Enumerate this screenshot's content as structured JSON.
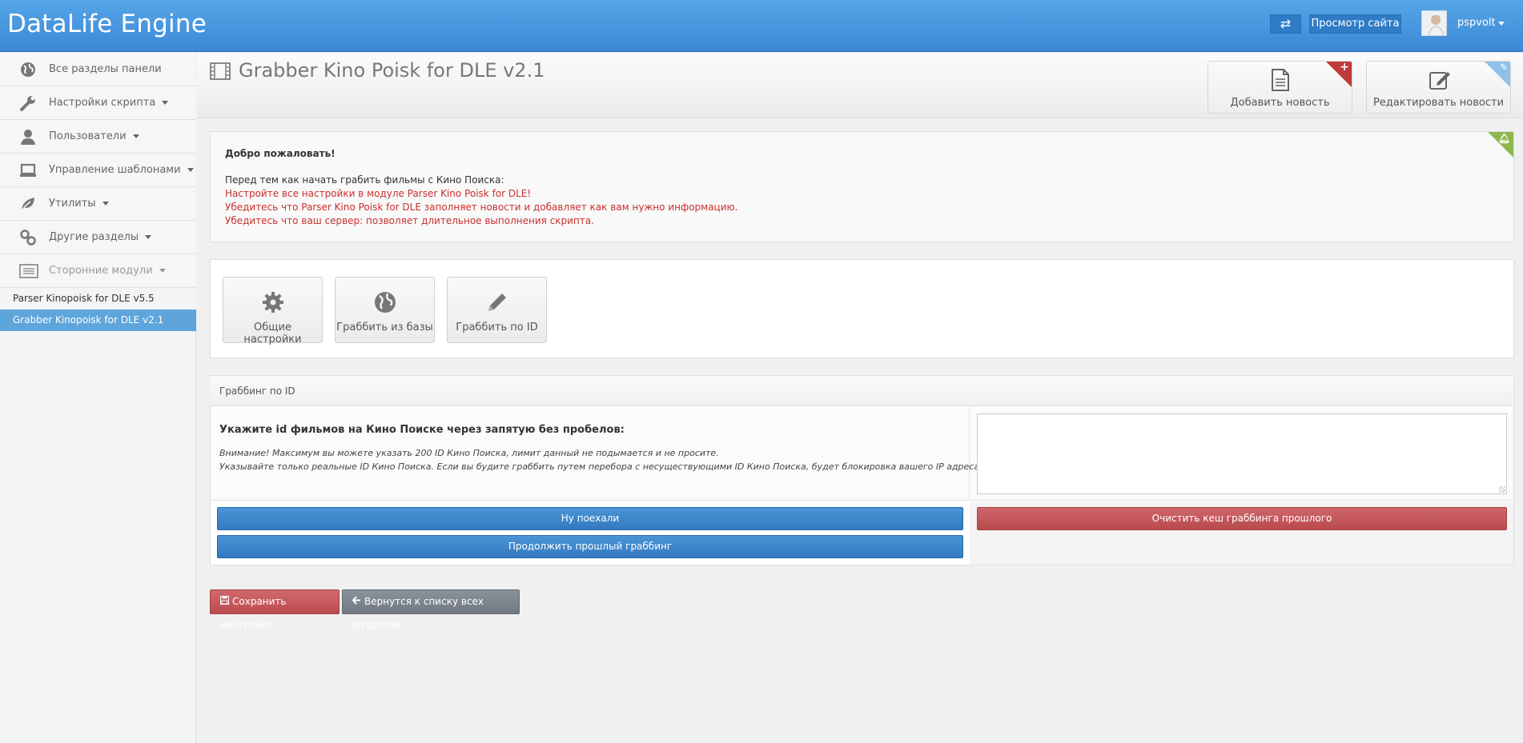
{
  "header": {
    "brand": "DataLife Engine",
    "swap_icon": "exchange-icon",
    "view_site_label": "Просмотр сайта",
    "username": "pspvolt"
  },
  "sidebar": {
    "items": [
      {
        "label": "Все разделы панели",
        "icon": "globe-icon",
        "has_caret": false
      },
      {
        "label": "Настройки скрипта",
        "icon": "wrench-icon",
        "has_caret": true
      },
      {
        "label": "Пользователи",
        "icon": "user-icon",
        "has_caret": true
      },
      {
        "label": "Управление шаблонами",
        "icon": "laptop-icon",
        "has_caret": true
      },
      {
        "label": "Утилиты",
        "icon": "leaf-icon",
        "has_caret": true
      },
      {
        "label": "Другие разделы",
        "icon": "link-icon",
        "has_caret": true
      },
      {
        "label": "Сторонние модули",
        "icon": "list-icon",
        "has_caret": true
      }
    ],
    "subitems": [
      {
        "label": "Parser Kinopoisk for DLE v5.5",
        "active": false
      },
      {
        "label": "Grabber Kinopoisk for DLE v2.1",
        "active": true
      }
    ]
  },
  "page": {
    "title": "Grabber Kino Poisk for DLE v2.1",
    "title_icon": "film-icon",
    "quick_actions": [
      {
        "label": "Добавить новость",
        "icon": "file-icon",
        "corner": "plus"
      },
      {
        "label": "Редактировать новости",
        "icon": "edit-icon",
        "corner": "pencil"
      }
    ]
  },
  "welcome": {
    "title": "Добро пожаловать!",
    "intro": "Перед тем как начать грабить фильмы с Кино Поиска:",
    "lines": [
      "Настройте все настройки в модуле Parser Kino Poisk for DLE!",
      "Убедитесь что Parser Kino Poisk for DLE заполняет новости и добавляет как вам нужно информацию.",
      "Убедитесь что ваш сервер: позволяет длительное выполнения скрипта."
    ],
    "corner_icon": "bell-icon"
  },
  "tabs": [
    {
      "label": "Общие настройки",
      "icon": "gear-icon"
    },
    {
      "label": "Граббить из базы",
      "icon": "globe-icon"
    },
    {
      "label": "Граббить по ID",
      "icon": "pencil-icon"
    }
  ],
  "grab": {
    "heading": "Граббинг по ID",
    "question": "Укажите id фильмов на Кино Поиске через запятую без пробелов:",
    "notes": [
      "Внимание! Максимум вы можете указать 200 ID Кино Поиска, лимит данный не подымается и не просите.",
      "Указывайте только реальные ID Кино Поиска. Если вы будите граббить путем перебора с несуществующими ID Кино Поиска, будет блокировка вашего IP адреса!"
    ],
    "ids_value": "",
    "start_label": "Ну поехали",
    "continue_label": "Продолжить прошлый граббинг",
    "clear_label": "Очистить кеш граббинга прошлого"
  },
  "footer": {
    "save_label": "Сохранить настройки",
    "back_label": "Вернутся к списку всех разделов"
  },
  "colors": {
    "header_blue": "#3b88d6",
    "active_blue": "#5ea5db",
    "danger_red": "#c9302c"
  }
}
